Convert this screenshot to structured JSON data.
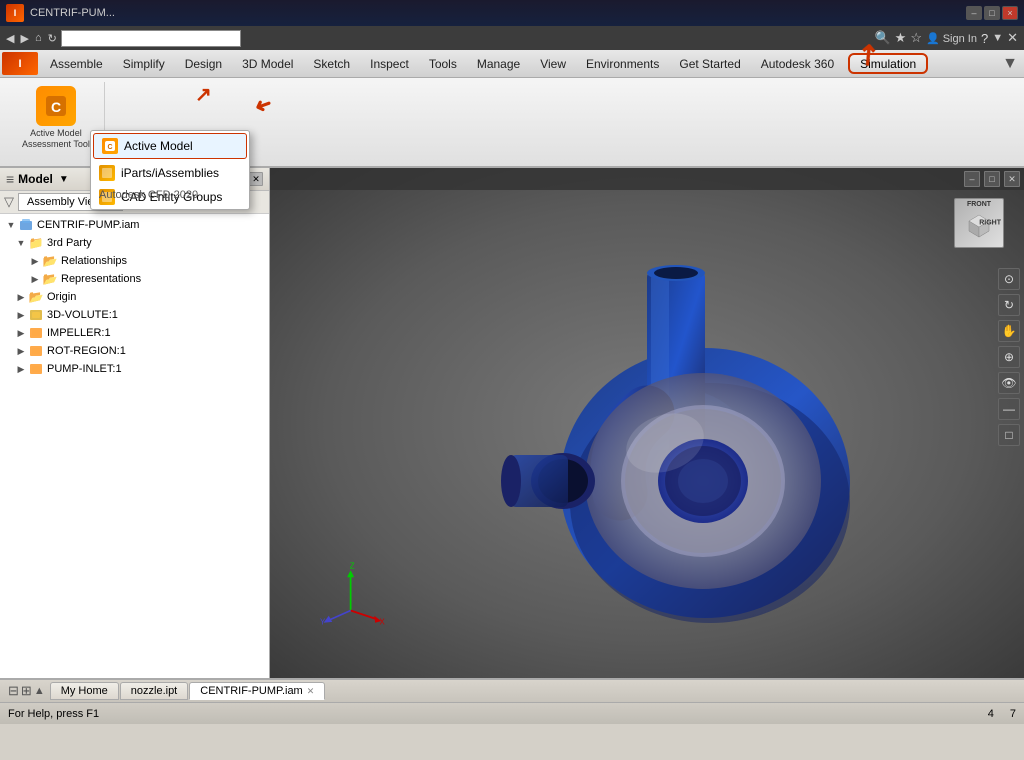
{
  "app": {
    "title": "CENTRIF-PUM...",
    "version": "2020"
  },
  "titlebar": {
    "title": "CENTRIF-PUM...",
    "min_label": "–",
    "max_label": "□",
    "close_label": "×"
  },
  "menu": {
    "items": [
      "Assemble",
      "Simplify",
      "Design",
      "3D Model",
      "Sketch",
      "Inspect",
      "Tools",
      "Manage",
      "View",
      "Environments",
      "Get Started",
      "Autodesk 360",
      "Simulation"
    ],
    "active": "Simulation"
  },
  "ribbon": {
    "active_model_label": "Active Model",
    "iparts_label": "iParts/iAssemblies",
    "cad_groups_label": "CAD Entity Groups",
    "autodesk_cfd_label": "Autodesk CFD 2020",
    "large_btn_label": "Active Model\nAssessment Tool"
  },
  "model_panel": {
    "title": "Model",
    "assembly_view": "Assembly View",
    "help_label": "?",
    "close_label": "×",
    "tree": {
      "root": "CENTRIF-PUMP.iam",
      "items": [
        {
          "label": "3rd Party",
          "indent": 1,
          "type": "folder",
          "expanded": true
        },
        {
          "label": "Relationships",
          "indent": 2,
          "type": "folder"
        },
        {
          "label": "Representations",
          "indent": 2,
          "type": "folder"
        },
        {
          "label": "Origin",
          "indent": 1,
          "type": "folder"
        },
        {
          "label": "3D-VOLUTE:1",
          "indent": 1,
          "type": "part"
        },
        {
          "label": "IMPELLER:1",
          "indent": 1,
          "type": "part"
        },
        {
          "label": "ROT-REGION:1",
          "indent": 1,
          "type": "part"
        },
        {
          "label": "PUMP-INLET:1",
          "indent": 1,
          "type": "part"
        }
      ]
    }
  },
  "viewport": {
    "nav_cube": {
      "front": "FRONT",
      "right": "RIGHT"
    }
  },
  "bottom_tabs": {
    "icons": [
      "⊟",
      "⊞"
    ],
    "tabs": [
      {
        "label": "My Home",
        "closeable": false
      },
      {
        "label": "nozzle.ipt",
        "closeable": false
      },
      {
        "label": "CENTRIF-PUMP.iam",
        "closeable": true,
        "active": true
      }
    ]
  },
  "statusbar": {
    "help_text": "For Help, press F1",
    "num1": "4",
    "num2": "7"
  },
  "dropdown": {
    "active_model": "Active Model",
    "iparts": "iParts/iAssemblies",
    "cad_groups": "CAD Entity Groups"
  }
}
